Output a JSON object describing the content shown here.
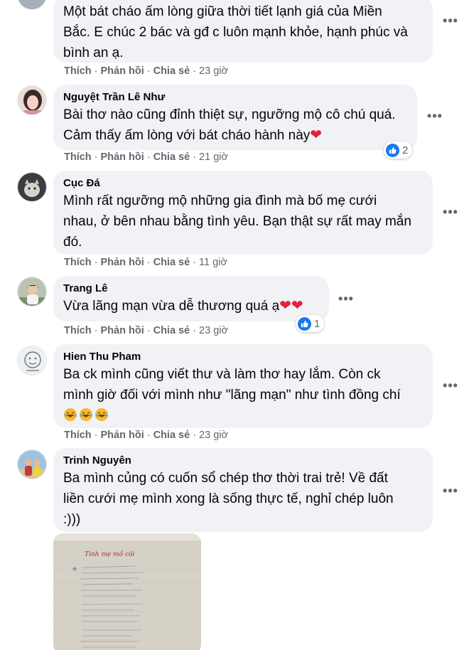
{
  "actions": {
    "like": "Thích",
    "reply": "Phản hồi",
    "share": "Chia sẻ",
    "sep": "·"
  },
  "comments": [
    {
      "author": "",
      "lines": [
        "Một bát cháo ấm lòng giữa thời tiết lạnh giá của Miền",
        "Bắc. E chúc 2 bác và gđ c luôn mạnh khỏe, hạnh phúc và",
        "bình an ạ."
      ],
      "time": "23 giờ"
    },
    {
      "author": "Nguyệt Trần Lê Như",
      "lines": [
        "Bài thơ nào cũng đỉnh thiệt sự, ngưỡng mộ cô chú quá.",
        "Cảm thấy ấm lòng với bát cháo hành này"
      ],
      "time": "21 giờ",
      "reaction_count": "2"
    },
    {
      "author": "Cục Đá",
      "lines": [
        "Mình rất ngưỡng mộ những gia đình mà bố mẹ cưới",
        "nhau, ở bên nhau bằng tình yêu. Bạn thật sự rất may mắn",
        "đó."
      ],
      "time": "11 giờ"
    },
    {
      "author": "Trang Lê",
      "lines": [
        "Vừa lãng mạn vừa dễ thương quá ạ"
      ],
      "time": "23 giờ",
      "reaction_count": "1"
    },
    {
      "author": "Hien Thu Pham",
      "lines": [
        "Ba ck mình cũng viết thư và làm thơ hay lắm. Còn ck",
        "mình giờ đối với mình như \"lãng mạn\" như tình đồng chí"
      ],
      "time": "23 giờ"
    },
    {
      "author": "Trinh Nguyên",
      "lines": [
        "Ba mình củng có cuốn sổ chép thơ thời trai trẻ! Về đất",
        "liền cưới mẹ mình xong là sống thực tế, nghỉ chép luôn",
        ":)))"
      ]
    }
  ],
  "photo": {
    "title": "Tình mẹ mồ côi"
  },
  "colors": {
    "bubble": "#f0f2f5",
    "meta": "#65676b",
    "like": "#1877f2",
    "heart": "#e41e3f"
  },
  "icons": {
    "more": "more-horizontal-icon",
    "like": "like-thumb-icon",
    "heart": "heart-emoji-icon",
    "laugh": "laughing-emoji-icon"
  }
}
